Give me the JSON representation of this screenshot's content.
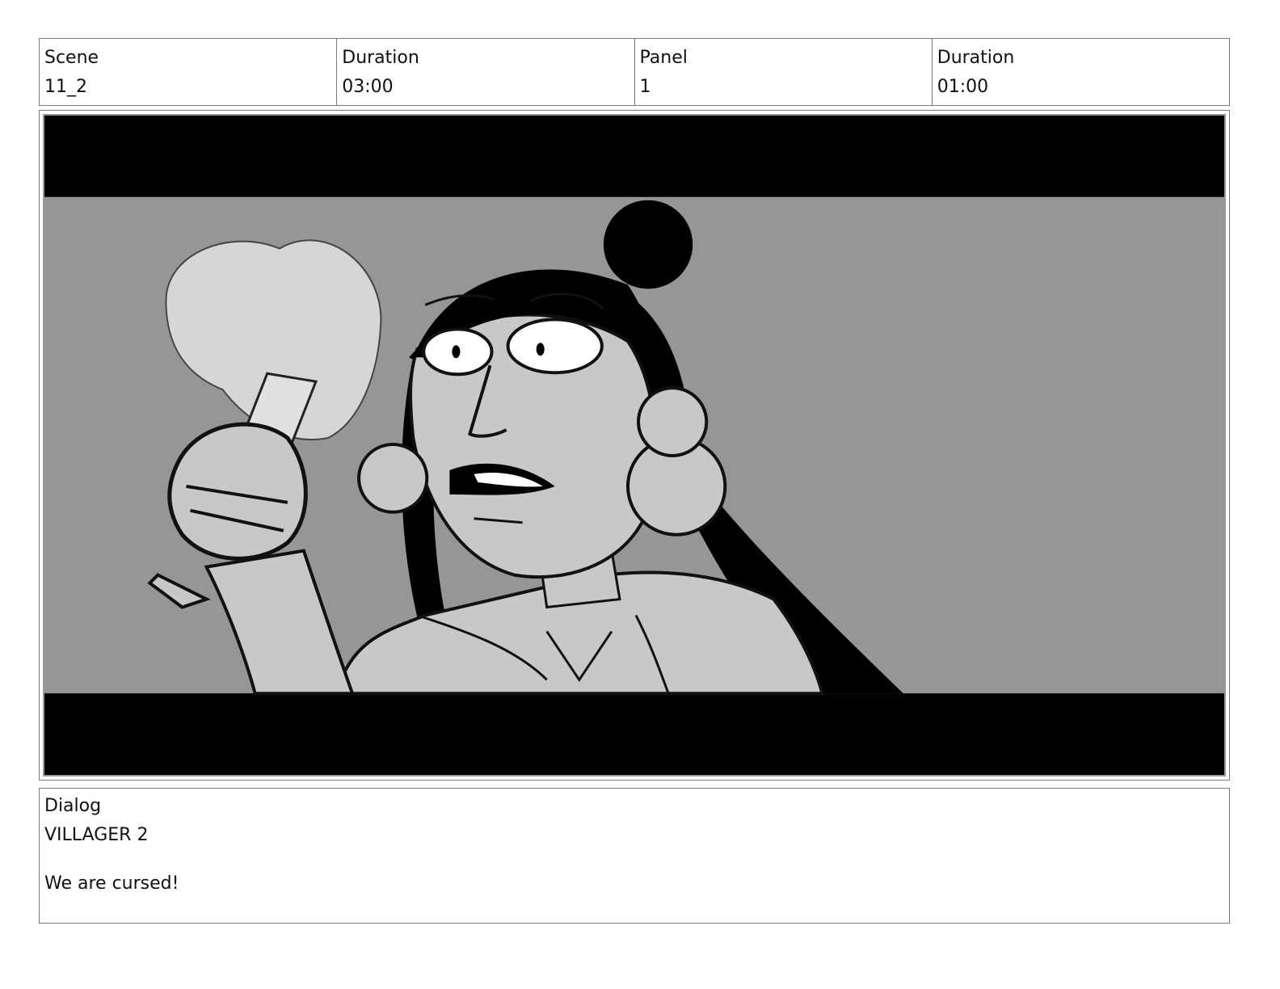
{
  "header": {
    "scene_label": "Scene",
    "scene_value": "11_2",
    "scene_duration_label": "Duration",
    "scene_duration_value": "03:00",
    "panel_label": "Panel",
    "panel_value": "1",
    "panel_duration_label": "Duration",
    "panel_duration_value": "01:00"
  },
  "panel": {
    "image_subject": "storyboard-sketch-villager-holding-torch",
    "colors": {
      "letterbox": "#000000",
      "background": "#969696",
      "skin": "#c8c8c8",
      "glow": "#d6d6d6",
      "eye_white": "#ffffff",
      "hair": "#000000"
    }
  },
  "dialog": {
    "label": "Dialog",
    "speaker": "VILLAGER 2",
    "line": "We are cursed!"
  }
}
